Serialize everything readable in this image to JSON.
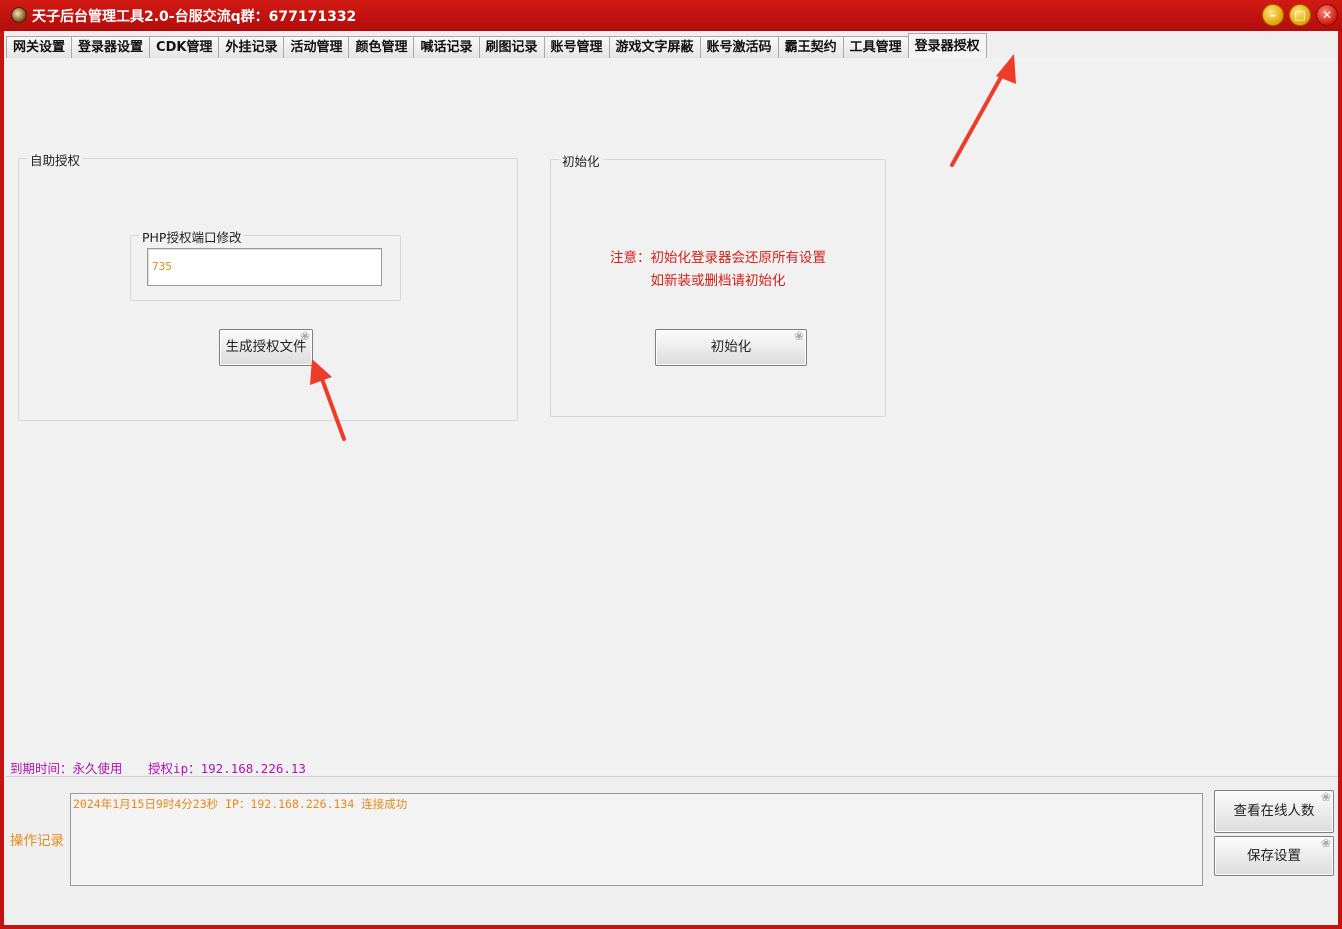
{
  "window": {
    "title": "天子后台管理工具2.0-台服交流q群：677171332",
    "minimize": "–",
    "maximize": "□",
    "close": "✕"
  },
  "tabs": [
    {
      "label": "网关设置"
    },
    {
      "label": "登录器设置"
    },
    {
      "label": "CDK管理"
    },
    {
      "label": "外挂记录"
    },
    {
      "label": "活动管理"
    },
    {
      "label": "颜色管理"
    },
    {
      "label": "喊话记录"
    },
    {
      "label": "刷图记录"
    },
    {
      "label": "账号管理"
    },
    {
      "label": "游戏文字屏蔽"
    },
    {
      "label": "账号激活码"
    },
    {
      "label": "霸王契约"
    },
    {
      "label": "工具管理"
    },
    {
      "label": "登录器授权",
      "active": true
    }
  ],
  "self_auth": {
    "group_label": "自助授权",
    "php_group_label": "PHP授权端口修改",
    "port_value": "735",
    "generate_button": "生成授权文件"
  },
  "init": {
    "group_label": "初始化",
    "warning_line1": "注意：初始化登录器会还原所有设置",
    "warning_line2": "如新装或删档请初始化",
    "init_button": "初始化"
  },
  "status": {
    "expire": "到期时间：永久使用",
    "auth_ip": "授权ip：192.168.226.13"
  },
  "log": {
    "label": "操作记录",
    "text": "2024年1月15日9时4分23秒 IP：192.168.226.134 连接成功"
  },
  "buttons": {
    "view_online": "查看在线人数",
    "save_settings": "保存设置"
  },
  "colors": {
    "title_bar": "#c41410",
    "warning": "#d2201a",
    "status": "#b113b1",
    "log_text": "#e48a1c",
    "arrow": "#ee3b2a"
  },
  "icons": {
    "button_decoration": "paw-icon"
  }
}
